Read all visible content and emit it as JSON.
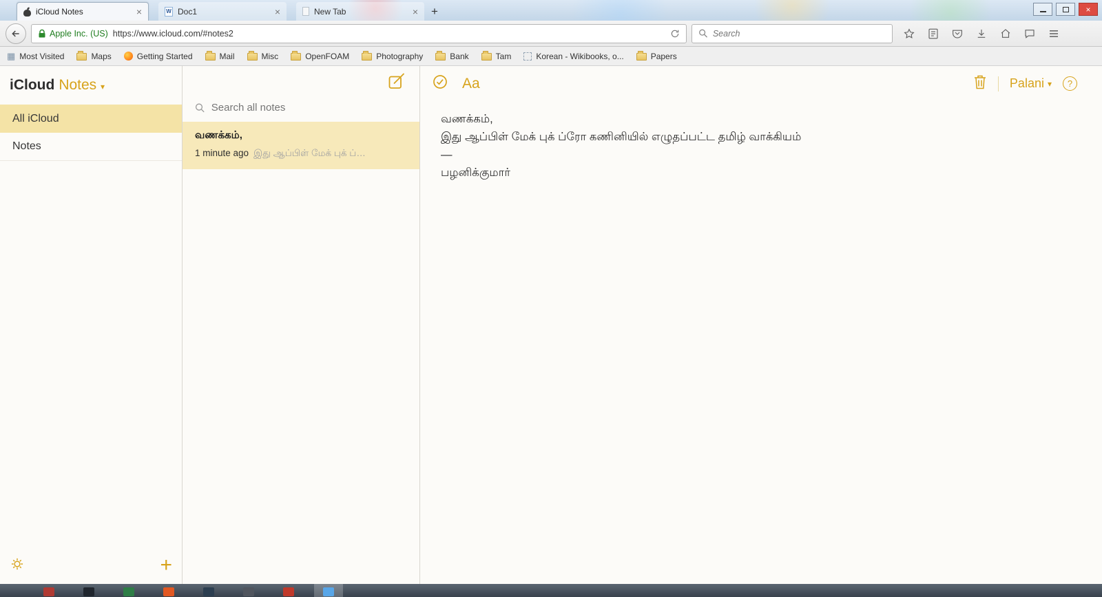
{
  "colors": {
    "accent_gold": "#d7a31c",
    "sidebar_selected_bg": "#f4e3a6",
    "note_selected_bg": "#f7e9ba",
    "security_green": "#1f7d1f",
    "close_button_red": "#dd4b42"
  },
  "browser": {
    "tabs": [
      {
        "title": "iCloud Notes"
      },
      {
        "title": "Doc1"
      },
      {
        "title": "New Tab"
      }
    ],
    "nav": {
      "security_label": "Apple Inc. (US)",
      "url": "https://www.icloud.com/#notes2",
      "search_placeholder": "Search"
    },
    "bookmarks": [
      "Most Visited",
      "Maps",
      "Getting Started",
      "Mail",
      "Misc",
      "OpenFOAM",
      "Photography",
      "Bank",
      "Tam",
      "Korean - Wikibooks, o...",
      "Papers"
    ]
  },
  "app": {
    "sidebar": {
      "brand": "iCloud",
      "section": "Notes",
      "items": [
        {
          "label": "All iCloud"
        },
        {
          "label": "Notes"
        }
      ]
    },
    "list": {
      "search_placeholder": "Search all notes",
      "notes": [
        {
          "title": "வணக்கம்,",
          "time": "1 minute ago",
          "preview": "இது ஆப்பிள் மேக் புக் ப்…"
        }
      ]
    },
    "editor": {
      "format_button": "Aa",
      "account": "Palani",
      "content_lines": [
        "வணக்கம்,",
        "இது ஆப்பிள் மேக் புக் ப்ரோ கணினியில் எழுதப்பட்ட தமிழ் வாக்கியம்",
        "—",
        "பழனிக்குமார்"
      ]
    }
  }
}
